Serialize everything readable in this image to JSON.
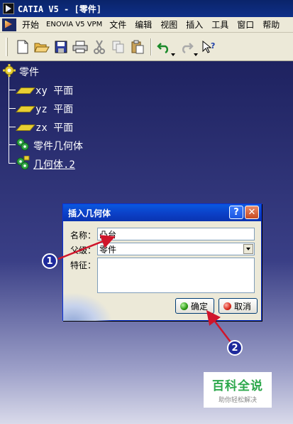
{
  "window": {
    "title": "CATIA V5 - [零件]"
  },
  "menubar": {
    "items": [
      {
        "label": "开始"
      },
      {
        "label": "ENOVIA V5 VPM"
      },
      {
        "label": "文件"
      },
      {
        "label": "编辑"
      },
      {
        "label": "视图"
      },
      {
        "label": "插入"
      },
      {
        "label": "工具"
      },
      {
        "label": "窗口"
      },
      {
        "label": "帮助"
      }
    ]
  },
  "toolbar": {
    "buttons": [
      "new-icon",
      "open-icon",
      "save-icon",
      "print-icon",
      "cut-icon",
      "copy-icon",
      "paste-icon",
      "undo-icon",
      "redo-icon",
      "whats-this-icon"
    ]
  },
  "tree": {
    "root": "零件",
    "planes": [
      "xy 平面",
      "yz 平面",
      "zx 平面"
    ],
    "body": "零件几何体",
    "new_body": "几何体.2"
  },
  "dialog": {
    "title": "插入几何体",
    "help_label": "?",
    "close_label": "✕",
    "name_label": "名称：",
    "name_value": "凸台",
    "parent_label": "父级：",
    "parent_value": "零件",
    "feature_label": "特征：",
    "ok_label": "确定",
    "cancel_label": "取消"
  },
  "annotations": {
    "callout_1": "1",
    "callout_2": "2"
  },
  "watermark": {
    "main": "百科全说",
    "sub": "助你轻松解决"
  },
  "colors": {
    "annotation_arrow": "#d0152b",
    "callout": "#1e2a9c",
    "background_top": "#1e2260"
  }
}
